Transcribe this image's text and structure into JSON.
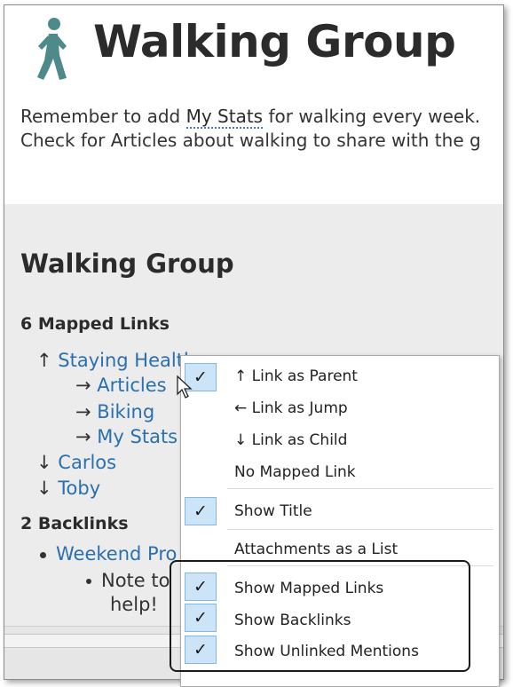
{
  "page": {
    "title": "Walking Group",
    "note_line1_before": "Remember to add ",
    "note_line1_mention": "My Stats",
    "note_line1_after": " for walking every week.",
    "note_line2": "Check for Articles about walking to share with the g"
  },
  "references": {
    "title": "Walking Group",
    "mapped_links_heading": "6 Mapped Links",
    "mapped_links": [
      {
        "arrow": "↑",
        "label": "Staying Healthy"
      },
      {
        "arrow": "→",
        "label": "Articles"
      },
      {
        "arrow": "→",
        "label": "Biking"
      },
      {
        "arrow": "→",
        "label": "My Stats"
      },
      {
        "arrow": "↓",
        "label": "Carlos"
      },
      {
        "arrow": "↓",
        "label": "Toby"
      }
    ],
    "backlinks_heading": "2 Backlinks",
    "backlinks": [
      {
        "label": "Weekend Pro"
      }
    ],
    "backlink_note": "Note to",
    "backlink_note_wrap": "help!"
  },
  "context_menu": {
    "items": [
      {
        "label": "↑ Link as Parent",
        "checked": true
      },
      {
        "label": "← Link as Jump",
        "checked": false
      },
      {
        "label": "↓ Link as Child",
        "checked": false
      },
      {
        "label": "No Mapped Link",
        "checked": false
      },
      {
        "label": "Show Title",
        "checked": true
      },
      {
        "label": "Attachments as a List",
        "checked": false
      },
      {
        "label": "Show Mapped Links",
        "checked": true
      },
      {
        "label": "Show Backlinks",
        "checked": true
      },
      {
        "label": "Show Unlinked Mentions",
        "checked": true
      }
    ],
    "check_glyph": "✓"
  },
  "icons": {
    "page_icon": "walking-person-icon",
    "cursor": "mouse-pointer-icon"
  },
  "colors": {
    "link": "#2a6fb0",
    "icon": "#4e8a8a",
    "check_bg": "#cce4f7",
    "check_border": "#84b7e3",
    "panel_bg": "#ececec"
  }
}
